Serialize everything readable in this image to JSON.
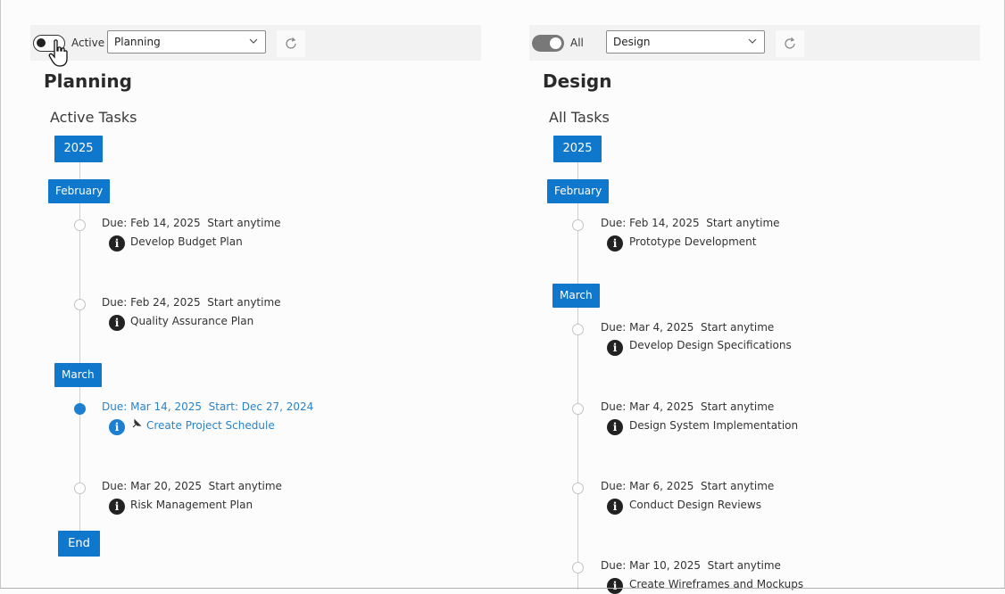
{
  "left_panel": {
    "toggle_label": "Active",
    "toggle_state": "off",
    "dropdown_value": "Planning",
    "title": "Planning",
    "subtitle": "Active Tasks",
    "year_label": "2025",
    "months": [
      {
        "label": "February",
        "tasks": [
          {
            "due": "Due: Feb 14, 2025",
            "start": "Start anytime",
            "name": "Develop Budget Plan",
            "highlighted": false
          },
          {
            "due": "Due: Feb 24, 2025",
            "start": "Start anytime",
            "name": "Quality Assurance Plan",
            "highlighted": false
          }
        ]
      },
      {
        "label": "March",
        "tasks": [
          {
            "due": "Due: Mar 14, 2025",
            "start": "Start: Dec 27, 2024",
            "name": "Create Project Schedule",
            "highlighted": true
          },
          {
            "due": "Due: Mar 20, 2025",
            "start": "Start anytime",
            "name": "Risk Management Plan",
            "highlighted": false
          }
        ]
      }
    ],
    "end_label": "End"
  },
  "right_panel": {
    "toggle_label": "All",
    "toggle_state": "on",
    "dropdown_value": "Design",
    "title": "Design",
    "subtitle": "All Tasks",
    "year_label": "2025",
    "months": [
      {
        "label": "February",
        "tasks": [
          {
            "due": "Due: Feb 14, 2025",
            "start": "Start anytime",
            "name": "Prototype Development",
            "highlighted": false
          }
        ]
      },
      {
        "label": "March",
        "tasks": [
          {
            "due": "Due: Mar 4, 2025",
            "start": "Start anytime",
            "name": "Develop Design Specifications",
            "highlighted": false
          },
          {
            "due": "Due: Mar 4, 2025",
            "start": "Start anytime",
            "name": "Design System Implementation",
            "highlighted": false
          },
          {
            "due": "Due: Mar 6, 2025",
            "start": "Start anytime",
            "name": "Conduct Design Reviews",
            "highlighted": false
          },
          {
            "due": "Due: Mar 10, 2025",
            "start": "Start anytime",
            "name": "Create Wireframes and Mockups",
            "highlighted": false
          }
        ]
      }
    ]
  },
  "icons": {
    "info": "info-icon",
    "refresh": "refresh-icon",
    "chevron": "chevron-down-icon",
    "pin": "pin-icon",
    "cursor": "hand-cursor-icon"
  },
  "colors": {
    "accent": "#0f78cc",
    "link": "#2a83c8",
    "toolbar_bg": "#f2f2f2"
  }
}
